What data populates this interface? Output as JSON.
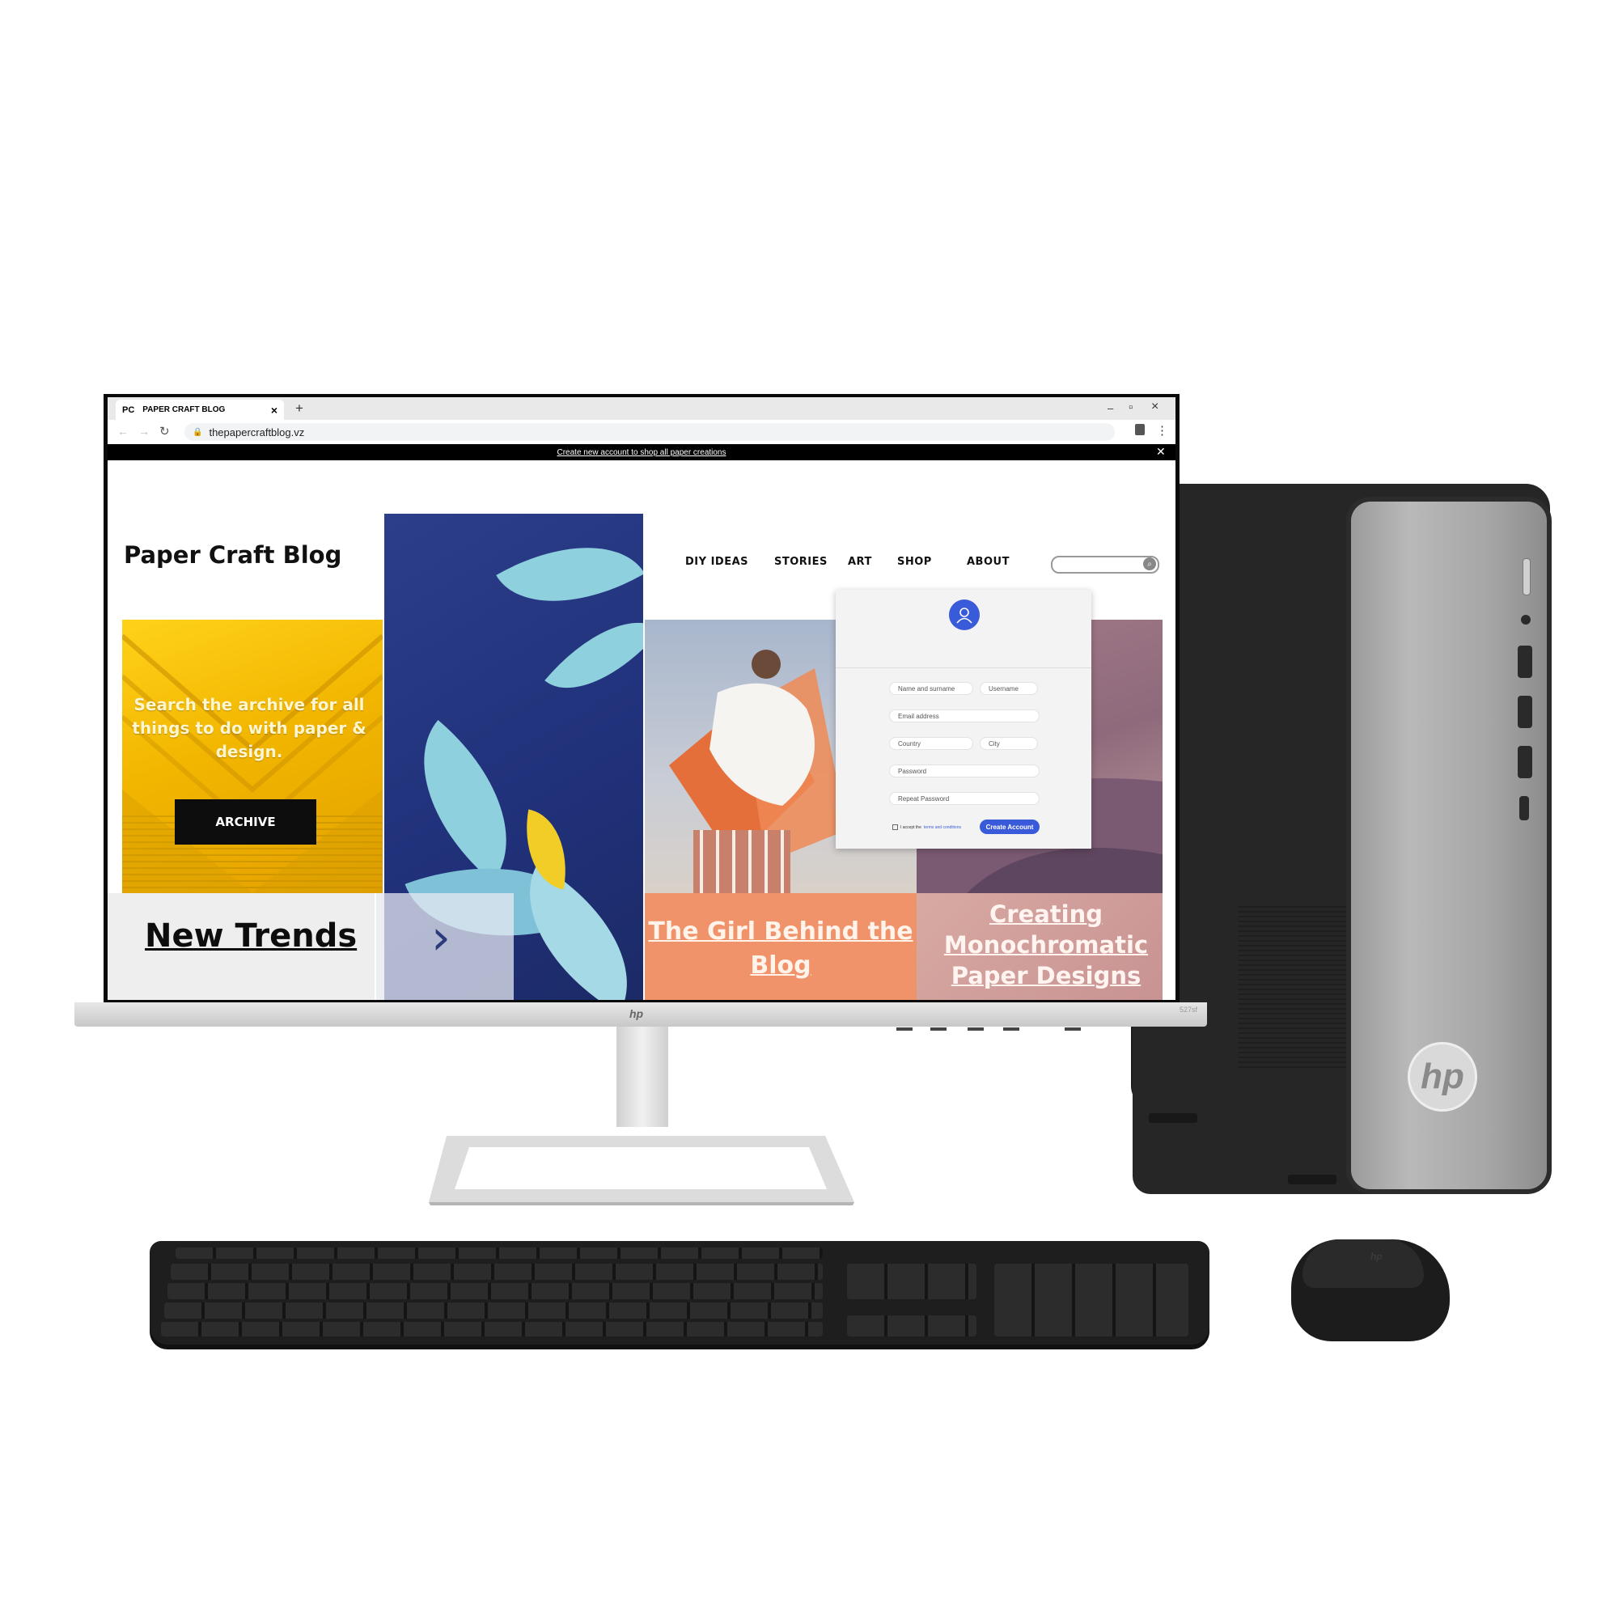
{
  "browser": {
    "tab_icon": "PC",
    "tab_title": "PAPER CRAFT BLOG",
    "tab_close": "×",
    "new_tab": "+",
    "url": "thepapercraftblog.vz",
    "window_minimize": "–",
    "window_restore": "▫",
    "window_close": "×"
  },
  "banner": {
    "text": "Create new account to shop all paper creations",
    "close": "✕"
  },
  "site": {
    "title": "Paper Craft Blog",
    "nav": [
      "DIY IDEAS",
      "STORIES",
      "ART",
      "SHOP",
      "ABOUT"
    ],
    "search_placeholder": ""
  },
  "tiles": {
    "archive_text": "Search the archive for all things to do with paper & design.",
    "archive_button": "ARCHIVE",
    "trends_title": "New Trends",
    "next_arrow": "›",
    "girl_title": "The Girl Behind the Blog",
    "mono_title": "Creating Monochromatic Paper Designs"
  },
  "signup": {
    "fields": {
      "name": "Name and surname",
      "username": "Username",
      "email": "Email address",
      "country": "Country",
      "city": "City",
      "password": "Password",
      "repeat_password": "Repeat Password"
    },
    "terms_prefix": "I accept the",
    "terms_link": "terms and conditions",
    "create_button": "Create Account"
  },
  "hardware": {
    "monitor_logo": "hp",
    "monitor_model": "527sf",
    "tower_logo": "hp",
    "mouse_logo": "hp"
  },
  "colors": {
    "accent_blue": "#3a5bd9",
    "yellow_tile": "#f2b600",
    "orange_tile": "#f0926a",
    "banner_bg": "#000000"
  }
}
